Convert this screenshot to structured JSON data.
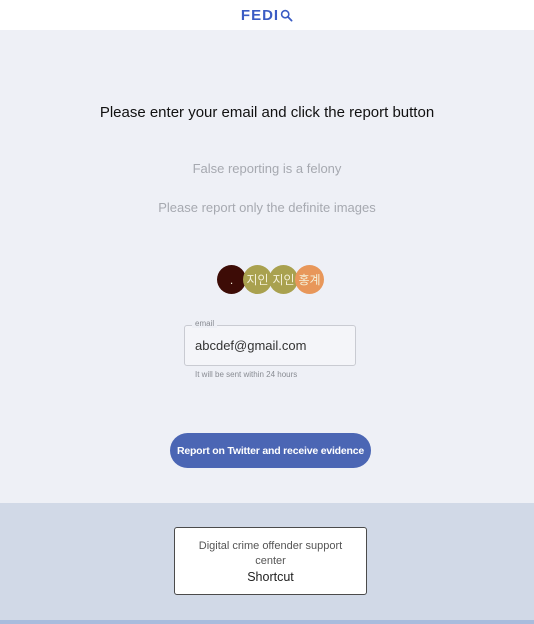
{
  "header": {
    "logo_text": "FEDI",
    "logo_icon": "magnifier-icon",
    "brand_color": "#3b5cc4"
  },
  "main": {
    "heading": "Please enter your email and click the report button",
    "notice_1": "False reporting is a felony",
    "notice_2": "Please report only the definite images",
    "avatars": [
      {
        "text": ".",
        "color": "#3d0c06"
      },
      {
        "text": "지인",
        "color": "#a9a14f"
      },
      {
        "text": "지인",
        "color": "#a9a14f"
      },
      {
        "text": "홍계",
        "color": "#e8975a"
      }
    ],
    "email": {
      "label": "email",
      "value": "abcdef@gmail.com",
      "helper": "It will be sent within 24 hours"
    },
    "report_button": "Report on Twitter and receive evidence",
    "button_color": "#4b66b4"
  },
  "footer": {
    "support_title": "Digital crime offender support center",
    "support_sub": "Shortcut"
  }
}
